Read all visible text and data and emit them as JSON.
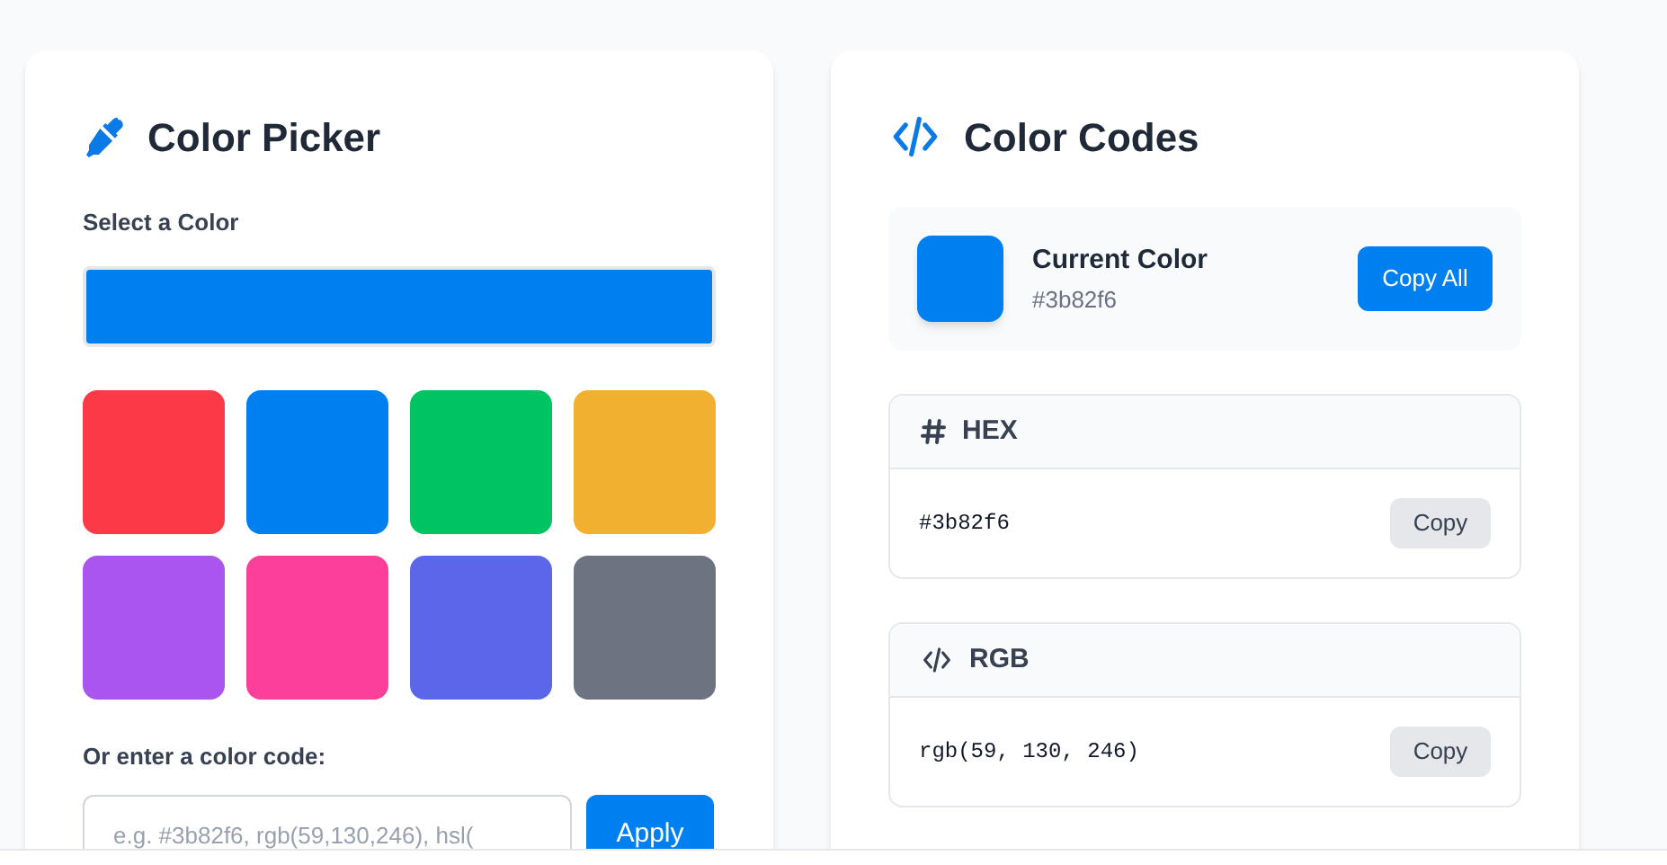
{
  "picker": {
    "title": "Color Picker",
    "select_label": "Select a Color",
    "color_input": {
      "color": "#0080f0"
    },
    "swatches": [
      {
        "color": "#fc3a47"
      },
      {
        "color": "#0080f0"
      },
      {
        "color": "#00c464"
      },
      {
        "color": "#f2b030"
      },
      {
        "color": "#ab55f0"
      },
      {
        "color": "#fc3f98"
      },
      {
        "color": "#5b67e8"
      },
      {
        "color": "#6b7480"
      }
    ],
    "code_label": "Or enter a color code:",
    "code_placeholder": "e.g. #3b82f6, rgb(59,130,246), hsl(",
    "apply_button": "Apply"
  },
  "codes": {
    "title": "Color Codes",
    "current": {
      "label": "Current Color",
      "value": "#3b82f6",
      "color": "#0080f0",
      "copy_all_button": "Copy All"
    },
    "formats": [
      {
        "kind": "hash",
        "name": "HEX",
        "value": "#3b82f6",
        "copy_button": "Copy"
      },
      {
        "kind": "code",
        "name": "RGB",
        "value": "rgb(59, 130, 246)",
        "copy_button": "Copy"
      }
    ]
  }
}
